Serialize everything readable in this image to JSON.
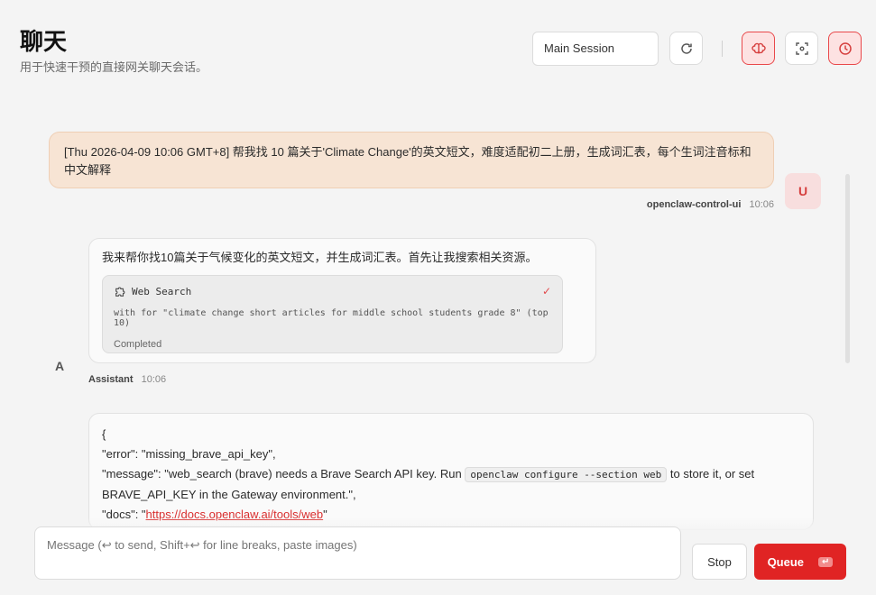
{
  "header": {
    "title": "聊天",
    "subtitle": "用于快速干预的直接网关聊天会话。",
    "session_label": "Main Session"
  },
  "colors": {
    "accent": "#e02424",
    "user_bubble": "#f7e4d4"
  },
  "messages": {
    "user": {
      "avatar": "U",
      "text": "[Thu 2026-04-09 10:06 GMT+8] 帮我找 10 篇关于'Climate Change'的英文短文，难度适配初二上册，生成词汇表，每个生词注音标和中文解释",
      "sender": "openclaw-control-ui",
      "time": "10:06"
    },
    "assistant": {
      "avatar": "A",
      "text": "我来帮你找10篇关于气候变化的英文短文，并生成词汇表。首先让我搜索相关资源。",
      "tool": {
        "name": "Web Search",
        "detail": "with for \"climate change short articles for middle school students grade 8\" (top 10)",
        "status": "Completed"
      },
      "sender": "Assistant",
      "time": "10:06"
    },
    "json": {
      "line1": "{",
      "line2": "\"error\": \"missing_brave_api_key\",",
      "line3_a": "\"message\": \"web_search (brave) needs a Brave Search API key. Run ",
      "line3_code": "openclaw configure --section web",
      "line3_b": " to store it, or set",
      "line4": "BRAVE_API_KEY in the Gateway environment.\",",
      "line5_a": "\"docs\": \"",
      "line5_link": "https://docs.openclaw.ai/tools/web",
      "line5_b": "\""
    }
  },
  "composer": {
    "placeholder": "Message (↩ to send, Shift+↩ for line breaks, paste images)",
    "stop_label": "Stop",
    "queue_label": "Queue",
    "queue_hint": "↵"
  }
}
